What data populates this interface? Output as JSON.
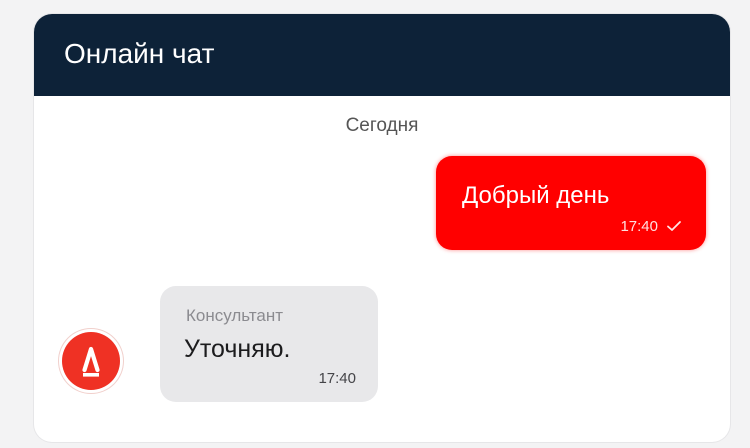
{
  "header": {
    "title": "Онлайн чат"
  },
  "chat": {
    "date_divider": "Сегодня",
    "messages": [
      {
        "direction": "outgoing",
        "text": "Добрый день",
        "time": "17:40",
        "status_icon": "check-icon"
      },
      {
        "direction": "incoming",
        "sender": "Консультант",
        "text": "Уточняю.",
        "time": "17:40",
        "avatar_icon": "alfa-logo-icon"
      }
    ]
  },
  "colors": {
    "header_bg": "#0d2238",
    "outgoing_bubble": "#ff0000",
    "incoming_bubble": "#e8e8ea",
    "avatar_bg": "#ef3124"
  }
}
